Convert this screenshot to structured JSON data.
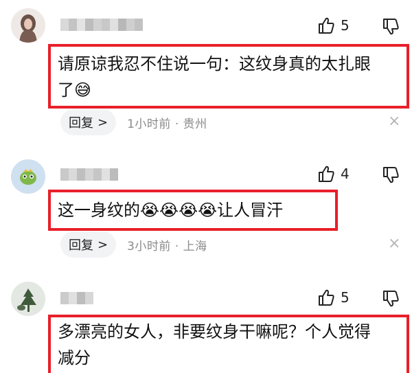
{
  "comments": [
    {
      "like_count": "5",
      "text_line1": "请原谅我忍不住说一句：这纹身真的太扎眼",
      "text_line2": "了😅",
      "reply_label": "回复",
      "reply_chevron": ">",
      "time_location": "1小时前 · 贵州",
      "close_symbol": "×"
    },
    {
      "like_count": "4",
      "text_line1": "这一身纹的😭😭😭😭让人冒汗",
      "reply_label": "回复",
      "reply_chevron": ">",
      "time_location": "3小时前 · 上海",
      "close_symbol": "×"
    },
    {
      "like_count": "5",
      "text_line1": "多漂亮的女人，非要纹身干嘛呢？个人觉得",
      "text_line2": "减分"
    }
  ],
  "icons": {
    "like": "thumbs-up-icon",
    "dislike": "thumbs-down-icon",
    "close": "close-icon"
  },
  "colors": {
    "highlight_border": "#e8202a",
    "meta_text": "#8a8a8a",
    "reply_bg": "#f2f3f5"
  }
}
